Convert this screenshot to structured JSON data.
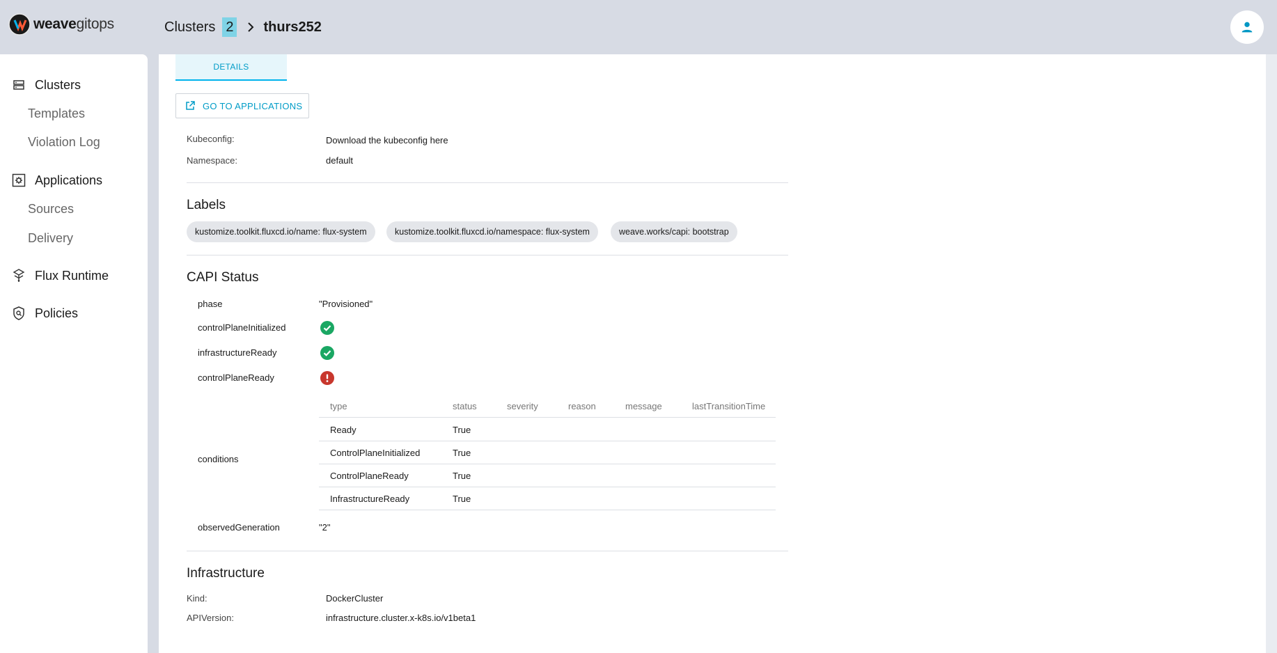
{
  "app": {
    "logo_bold": "weave",
    "logo_light": "gitops"
  },
  "breadcrumb": {
    "parent": "Clusters",
    "count": "2",
    "current": "thurs252"
  },
  "sidebar": {
    "clusters": "Clusters",
    "templates": "Templates",
    "violation_log": "Violation Log",
    "applications": "Applications",
    "sources": "Sources",
    "delivery": "Delivery",
    "flux_runtime": "Flux Runtime",
    "policies": "Policies"
  },
  "tabs": {
    "details": "DETAILS"
  },
  "actions": {
    "go_to_applications": "GO TO APPLICATIONS"
  },
  "details": {
    "kubeconfig_label": "Kubeconfig:",
    "kubeconfig_value": "Download the kubeconfig here",
    "namespace_label": "Namespace:",
    "namespace_value": "default"
  },
  "labels": {
    "title": "Labels",
    "items": [
      "kustomize.toolkit.fluxcd.io/name: flux-system",
      "kustomize.toolkit.fluxcd.io/namespace: flux-system",
      "weave.works/capi: bootstrap"
    ]
  },
  "capi_status": {
    "title": "CAPI Status",
    "phase_label": "phase",
    "phase_value": "\"Provisioned\"",
    "control_plane_initialized_label": "controlPlaneInitialized",
    "infrastructure_ready_label": "infrastructureReady",
    "control_plane_ready_label": "controlPlaneReady",
    "conditions_label": "conditions",
    "observed_generation_label": "observedGeneration",
    "observed_generation_value": "\"2\"",
    "colors": {
      "ok": "#1aa763",
      "error": "#c8372d"
    },
    "conditions": {
      "headers": {
        "type": "type",
        "status": "status",
        "severity": "severity",
        "reason": "reason",
        "message": "message",
        "last_transition_time": "lastTransitionTime"
      },
      "rows": [
        {
          "type": "Ready",
          "status": "True"
        },
        {
          "type": "ControlPlaneInitialized",
          "status": "True"
        },
        {
          "type": "ControlPlaneReady",
          "status": "True"
        },
        {
          "type": "InfrastructureReady",
          "status": "True"
        }
      ]
    }
  },
  "infrastructure": {
    "title": "Infrastructure",
    "kind_label": "Kind:",
    "kind_value": "DockerCluster",
    "api_version_label": "APIVersion:",
    "api_version_value": "infrastructure.cluster.x-k8s.io/v1beta1"
  }
}
